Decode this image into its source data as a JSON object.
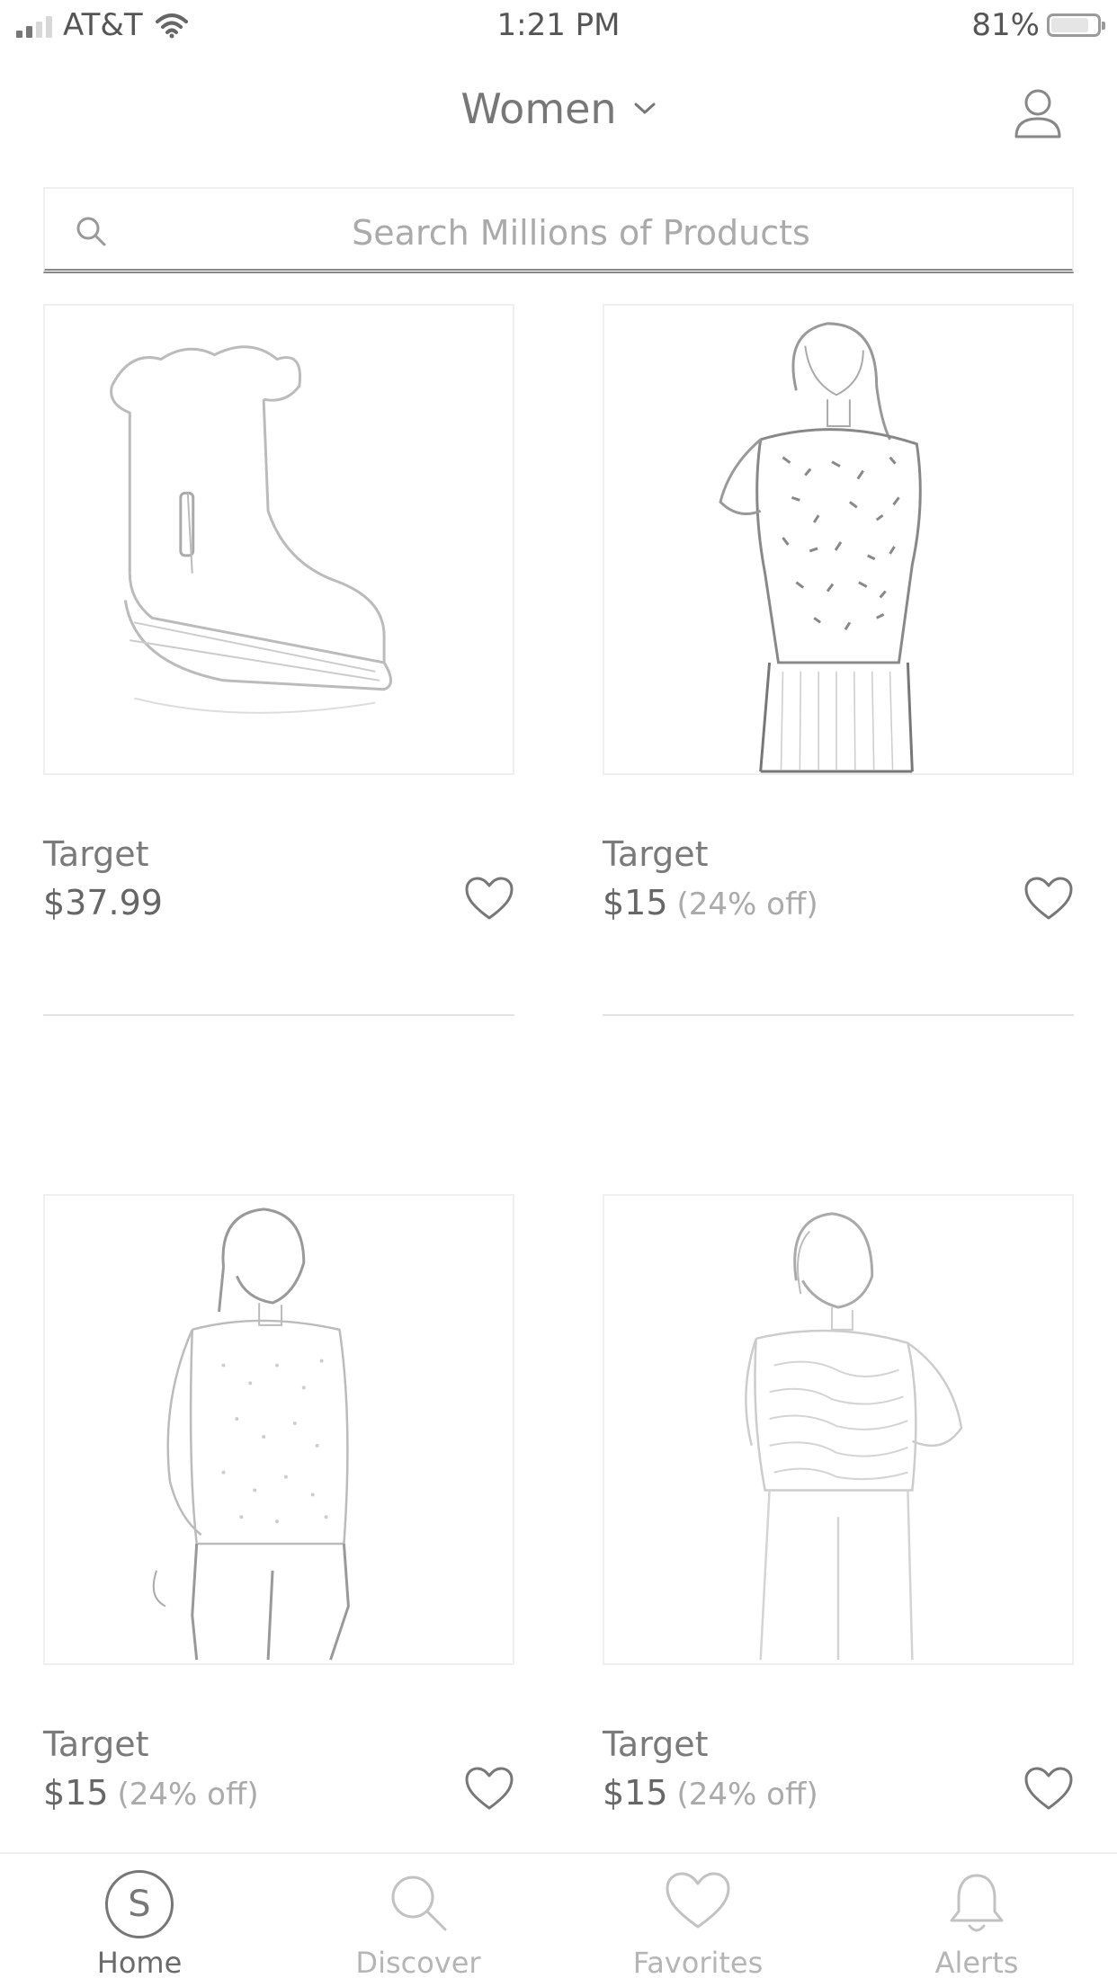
{
  "status_bar": {
    "carrier": "AT&T",
    "time": "1:21 PM",
    "battery_percent": "81%",
    "battery_level": 0.81,
    "signal_bars": 2,
    "wifi_icon": "wifi-icon"
  },
  "header": {
    "category": "Women",
    "chevron_icon": "chevron-down-icon",
    "profile_icon": "person-icon"
  },
  "search": {
    "placeholder": "Search Millions of Products",
    "icon": "search-icon"
  },
  "products": [
    {
      "brand": "Target",
      "price": "$37.99",
      "discount": "",
      "image": "fur-trim-ankle-boot",
      "favorite_icon": "heart-icon"
    },
    {
      "brand": "Target",
      "price": "$15",
      "discount": "(24% off)",
      "image": "model-leopard-print-sweater",
      "favorite_icon": "heart-icon"
    },
    {
      "brand": "Target",
      "price": "$15",
      "discount": "(24% off)",
      "image": "model-speckled-sweater",
      "favorite_icon": "heart-icon"
    },
    {
      "brand": "Target",
      "price": "$15",
      "discount": "(24% off)",
      "image": "model-zebra-print-sweater",
      "favorite_icon": "heart-icon"
    }
  ],
  "tab_bar": {
    "active": "Home",
    "tabs": [
      {
        "label": "Home",
        "icon": "home-s-icon",
        "home_letter": "S"
      },
      {
        "label": "Discover",
        "icon": "search-icon"
      },
      {
        "label": "Favorites",
        "icon": "heart-icon"
      },
      {
        "label": "Alerts",
        "icon": "bell-icon"
      }
    ]
  }
}
